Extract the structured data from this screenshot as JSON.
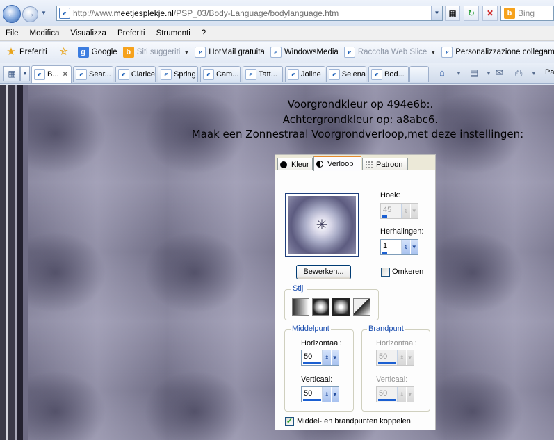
{
  "browser": {
    "address": {
      "url_prefix": "http://www.",
      "url_domain": "meetjesplekje.nl",
      "url_path": "/PSP_03/Body-Language/bodylanguage.htm"
    },
    "search": {
      "placeholder": "Bing"
    },
    "menu": [
      "File",
      "Modifica",
      "Visualizza",
      "Preferiti",
      "Strumenti",
      "?"
    ],
    "favorites": {
      "favorites_label": "Preferiti",
      "items": [
        {
          "label": "Google",
          "icon": "google-icon"
        },
        {
          "label": "Siti suggeriti",
          "icon": "bing-icon",
          "dim": true
        },
        {
          "label": "HotMail gratuita",
          "icon": "ie-page-icon"
        },
        {
          "label": "WindowsMedia",
          "icon": "ie-page-icon"
        },
        {
          "label": "Raccolta Web Slice",
          "icon": "ie-page-icon",
          "dim": true
        },
        {
          "label": "Personalizzazione collegamenti",
          "icon": "ie-page-icon"
        }
      ]
    },
    "tabs": [
      {
        "label": "B...",
        "active": true
      },
      {
        "label": "Sear..."
      },
      {
        "label": "Clarice"
      },
      {
        "label": "Spring"
      },
      {
        "label": "Cam..."
      },
      {
        "label": "Tatt..."
      },
      {
        "label": "Joline"
      },
      {
        "label": "Selena"
      },
      {
        "label": "Bod..."
      }
    ],
    "command_partial": "Pa"
  },
  "page": {
    "instructions": [
      "Voorgrondkleur op 494e6b:.",
      "Achtergrondkleur op: a8abc6.",
      "Maak een Zonnestraal Voorgrondverloop,met deze instellingen:"
    ],
    "colors": {
      "foreground": "#494e6b",
      "background": "#a8abc6"
    }
  },
  "dialog": {
    "tabs": {
      "kleur": "Kleur",
      "verloop": "Verloop",
      "patroon": "Patroon"
    },
    "hoek": {
      "label": "Hoek:",
      "value": "45"
    },
    "herhalingen": {
      "label": "Herhalingen:",
      "value": "1"
    },
    "bewerken": "Bewerken...",
    "omkeren": "Omkeren",
    "stijl": "Stijl",
    "middelpunt": {
      "title": "Middelpunt",
      "horizontaal_label": "Horizontaal:",
      "horizontaal": "50",
      "verticaal_label": "Verticaal:",
      "verticaal": "50"
    },
    "brandpunt": {
      "title": "Brandpunt",
      "horizontaal_label": "Horizontaal:",
      "horizontaal": "50",
      "verticaal_label": "Verticaal:",
      "verticaal": "50"
    },
    "koppelen": "Middel- en brandpunten koppelen"
  }
}
